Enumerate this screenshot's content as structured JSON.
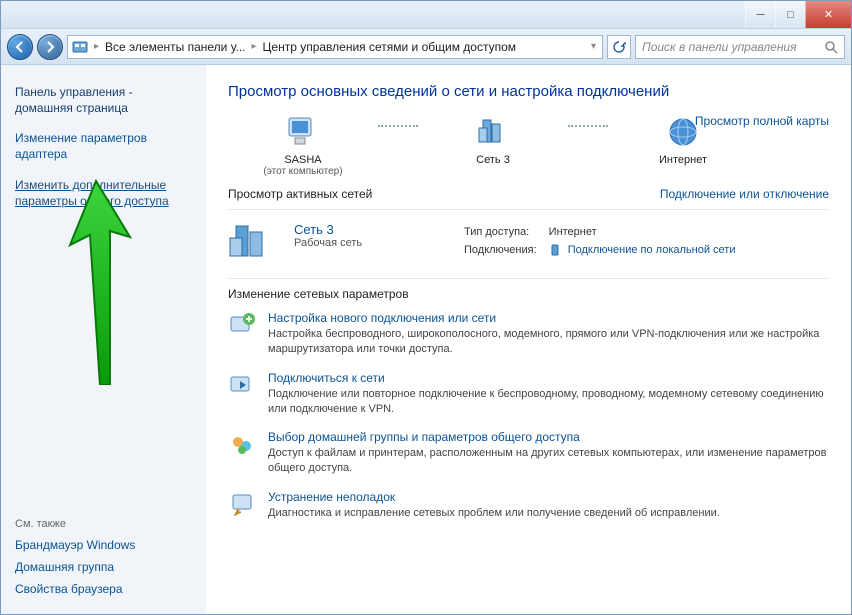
{
  "titlebar": {},
  "nav": {
    "breadcrumb_root": "Все элементы панели у...",
    "breadcrumb_current": "Центр управления сетями и общим доступом",
    "search_placeholder": "Поиск в панели управления"
  },
  "sidebar": {
    "home_title": "Панель управления - домашняя страница",
    "link_adapter": "Изменение параметров адаптера",
    "link_sharing": "Изменить дополнительные параметры общего доступа",
    "see_also": "См. также",
    "firewall": "Брандмауэр Windows",
    "homegroup": "Домашняя группа",
    "browser": "Свойства браузера"
  },
  "main": {
    "title": "Просмотр основных сведений о сети и настройка подключений",
    "map": {
      "node1": "SASHA",
      "node1_sub": "(этот компьютер)",
      "node2": "Сеть 3",
      "node3": "Интернет",
      "full_map": "Просмотр полной карты"
    },
    "active_heading": "Просмотр активных сетей",
    "connect_link": "Подключение или отключение",
    "active": {
      "name": "Сеть 3",
      "type": "Рабочая сеть",
      "access_label": "Тип доступа:",
      "access_value": "Интернет",
      "conn_label": "Подключения:",
      "conn_value": "Подключение по локальной сети"
    },
    "change_heading": "Изменение сетевых параметров",
    "tasks": [
      {
        "title": "Настройка нового подключения или сети",
        "desc": "Настройка беспроводного, широкополосного, модемного, прямого или VPN-подключения или же настройка маршрутизатора или точки доступа."
      },
      {
        "title": "Подключиться к сети",
        "desc": "Подключение или повторное подключение к беспроводному, проводному, модемному сетевому соединению или подключение к VPN."
      },
      {
        "title": "Выбор домашней группы и параметров общего доступа",
        "desc": "Доступ к файлам и принтерам, расположенным на других сетевых компьютерах, или изменение параметров общего доступа."
      },
      {
        "title": "Устранение неполадок",
        "desc": "Диагностика и исправление сетевых проблем или получение сведений об исправлении."
      }
    ]
  }
}
